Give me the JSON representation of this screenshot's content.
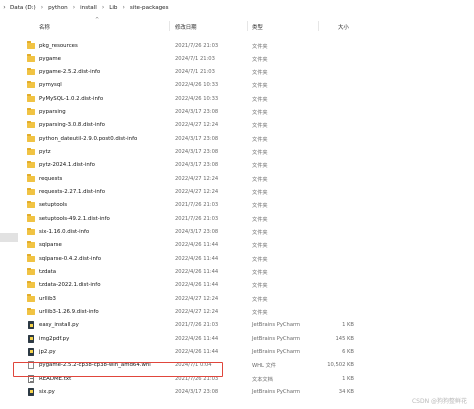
{
  "breadcrumb": {
    "items": [
      "Data (D:)",
      "python",
      "install",
      "Lib",
      "site-packages"
    ],
    "chevron": "chevron-right-icon"
  },
  "columns": {
    "name": "名称",
    "date": "修改日期",
    "type": "类型",
    "size": "大小"
  },
  "rows": [
    {
      "name": "pkg_resources",
      "date": "2021/7/26 21:03",
      "type": "文件夹",
      "size": "",
      "icon": "folder-icon"
    },
    {
      "name": "pygame",
      "date": "2024/7/1 21:03",
      "type": "文件夹",
      "size": "",
      "icon": "folder-icon"
    },
    {
      "name": "pygame-2.5.2.dist-info",
      "date": "2024/7/1 21:03",
      "type": "文件夹",
      "size": "",
      "icon": "folder-icon"
    },
    {
      "name": "pymysql",
      "date": "2022/4/26 10:33",
      "type": "文件夹",
      "size": "",
      "icon": "folder-icon"
    },
    {
      "name": "PyMySQL-1.0.2.dist-info",
      "date": "2022/4/26 10:33",
      "type": "文件夹",
      "size": "",
      "icon": "folder-icon"
    },
    {
      "name": "pyparsing",
      "date": "2024/3/17 23:08",
      "type": "文件夹",
      "size": "",
      "icon": "folder-icon"
    },
    {
      "name": "pyparsing-3.0.8.dist-info",
      "date": "2022/4/27 12:24",
      "type": "文件夹",
      "size": "",
      "icon": "folder-icon"
    },
    {
      "name": "python_dateutil-2.9.0.post0.dist-info",
      "date": "2024/3/17 23:08",
      "type": "文件夹",
      "size": "",
      "icon": "folder-icon"
    },
    {
      "name": "pytz",
      "date": "2024/3/17 23:08",
      "type": "文件夹",
      "size": "",
      "icon": "folder-icon"
    },
    {
      "name": "pytz-2024.1.dist-info",
      "date": "2024/3/17 23:08",
      "type": "文件夹",
      "size": "",
      "icon": "folder-icon"
    },
    {
      "name": "requests",
      "date": "2022/4/27 12:24",
      "type": "文件夹",
      "size": "",
      "icon": "folder-icon"
    },
    {
      "name": "requests-2.27.1.dist-info",
      "date": "2022/4/27 12:24",
      "type": "文件夹",
      "size": "",
      "icon": "folder-icon"
    },
    {
      "name": "setuptools",
      "date": "2021/7/26 21:03",
      "type": "文件夹",
      "size": "",
      "icon": "folder-icon"
    },
    {
      "name": "setuptools-49.2.1.dist-info",
      "date": "2021/7/26 21:03",
      "type": "文件夹",
      "size": "",
      "icon": "folder-icon"
    },
    {
      "name": "six-1.16.0.dist-info",
      "date": "2024/3/17 23:08",
      "type": "文件夹",
      "size": "",
      "icon": "folder-icon"
    },
    {
      "name": "sqlparse",
      "date": "2022/4/26 11:44",
      "type": "文件夹",
      "size": "",
      "icon": "folder-icon"
    },
    {
      "name": "sqlparse-0.4.2.dist-info",
      "date": "2022/4/26 11:44",
      "type": "文件夹",
      "size": "",
      "icon": "folder-icon"
    },
    {
      "name": "tzdata",
      "date": "2022/4/26 11:44",
      "type": "文件夹",
      "size": "",
      "icon": "folder-icon"
    },
    {
      "name": "tzdata-2022.1.dist-info",
      "date": "2022/4/26 11:44",
      "type": "文件夹",
      "size": "",
      "icon": "folder-icon"
    },
    {
      "name": "urllib3",
      "date": "2022/4/27 12:24",
      "type": "文件夹",
      "size": "",
      "icon": "folder-icon"
    },
    {
      "name": "urllib3-1.26.9.dist-info",
      "date": "2022/4/27 12:24",
      "type": "文件夹",
      "size": "",
      "icon": "folder-icon"
    },
    {
      "name": "easy_install.py",
      "date": "2021/7/26 21:03",
      "type": "JetBrains PyCharm",
      "size": "1 KB",
      "icon": "python-file-icon"
    },
    {
      "name": "img2pdf.py",
      "date": "2022/4/26 11:44",
      "type": "JetBrains PyCharm",
      "size": "145 KB",
      "icon": "python-file-icon"
    },
    {
      "name": "jp2.py",
      "date": "2022/4/26 11:44",
      "type": "JetBrains PyCharm",
      "size": "6 KB",
      "icon": "python-file-icon"
    },
    {
      "name": "pygame-2.5.2-cp38-cp38-win_amd64.whl",
      "date": "2024/7/1 0:04",
      "type": "WHL 文件",
      "size": "10,502 KB",
      "icon": "document-icon"
    },
    {
      "name": "README.txt",
      "date": "2021/7/26 21:03",
      "type": "文本文档",
      "size": "1 KB",
      "icon": "text-file-icon"
    },
    {
      "name": "six.py",
      "date": "2024/3/17 23:08",
      "type": "JetBrains PyCharm",
      "size": "34 KB",
      "icon": "python-file-icon"
    }
  ],
  "watermark": "CSDN @狗狗整鲜花",
  "colors": {
    "folder": "#f1c343",
    "highlight": "#e0463c",
    "secondary_text": "#6a6a6a"
  }
}
